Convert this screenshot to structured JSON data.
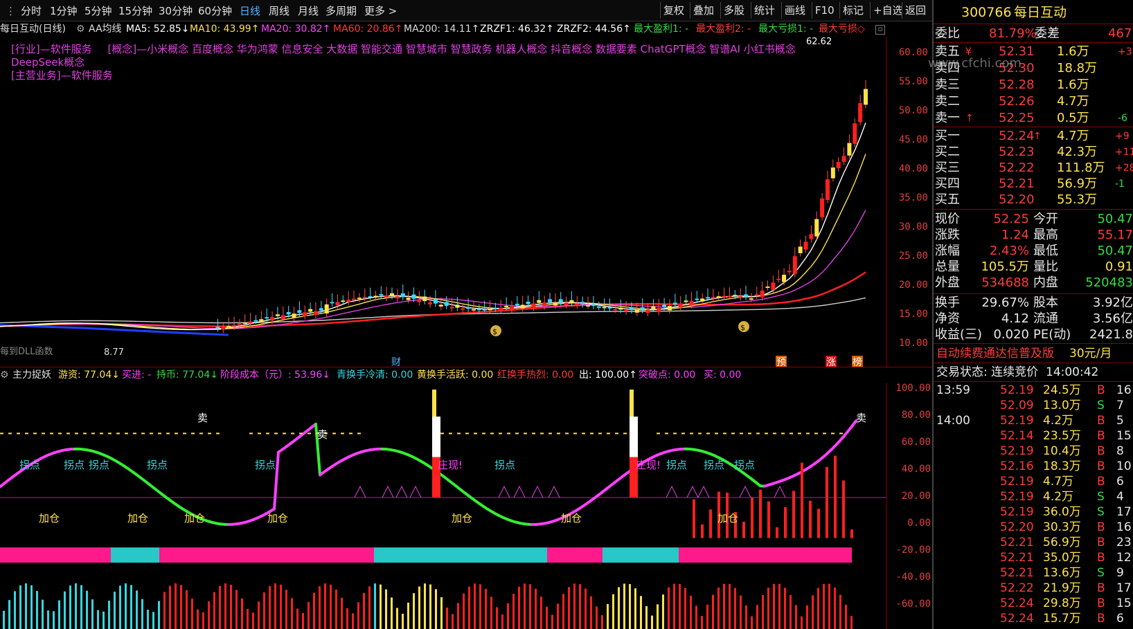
{
  "toolbar": {
    "periods": [
      "分时",
      "1分钟",
      "5分钟",
      "15分钟",
      "30分钟",
      "60分钟",
      "日线",
      "周线",
      "月线",
      "多周期",
      "更多 >"
    ],
    "active_period": "日线",
    "buttons": [
      "复权",
      "叠加",
      "多股",
      "统计",
      "画线",
      "F10",
      "标记",
      "+自选",
      "返回"
    ]
  },
  "main_chart": {
    "title": "每日互动(日线)",
    "indicator_name": "AA均线",
    "ma_labels": [
      {
        "text": "MA5: 52.85↓",
        "color": "#ffffff"
      },
      {
        "text": "MA10: 43.99↑",
        "color": "#ffe34a"
      },
      {
        "text": "MA20: 30.82↑",
        "color": "#ff40ff"
      },
      {
        "text": "MA60: 20.86↑",
        "color": "#ff3b3b"
      },
      {
        "text": "MA200: 14.11↑",
        "color": "#dddddd"
      },
      {
        "text": "ZRZF1: 46.32↑",
        "color": "#ffffff"
      },
      {
        "text": "ZRZF2: 44.56↑",
        "color": "#ffffff"
      },
      {
        "text": "最大盈利1: -",
        "color": "#33dd44"
      },
      {
        "text": "最大盈利2: -",
        "color": "#ff3b3b"
      },
      {
        "text": "最大亏损1: -",
        "color": "#33dd44"
      },
      {
        "text": "最大亏损◇",
        "color": "#ff3b3b"
      }
    ],
    "industry": "[行业]—软件服务",
    "concepts": "[概念]—小米概念 百度概念 华为鸿蒙 信息安全 大数据 智能交通 智慧城市 智慧政务 机器人概念 抖音概念 数据要素 ChatGPT概念 智谱AI 小红书概念 DeepSeek概念",
    "main_business": "[主营业务]—软件服务",
    "high_label": "62.62",
    "low_label": "8.77",
    "bottom_left_label": "每到DLL函数",
    "event_markers": [
      "财",
      "预",
      "涨",
      "榜"
    ],
    "y_axis": [
      "60.00",
      "55.00",
      "50.00",
      "45.00",
      "40.00",
      "35.00",
      "30.00",
      "25.00",
      "20.00",
      "15.00",
      "10.00"
    ],
    "watermark": "www.cfchi.com"
  },
  "indicator_chart": {
    "name": "主力捉妖",
    "labels": [
      {
        "text": "游资: 77.04↓",
        "color": "#ffe34a"
      },
      {
        "text": "买进: -",
        "color": "#ff40ff"
      },
      {
        "text": "持币: 77.04↓",
        "color": "#33dd44"
      },
      {
        "text": "阶段成本（元）: 53.96↓",
        "color": "#ff40ff"
      },
      {
        "text": "青换手冷清: 0.00",
        "color": "#36d6e0"
      },
      {
        "text": "黄换手活跃: 0.00",
        "color": "#ffe34a"
      },
      {
        "text": "红换手热烈: 0.00",
        "color": "#ff3b3b"
      },
      {
        "text": "出: 100.00↑",
        "color": "#ffffff"
      },
      {
        "text": "突破点: 0.00",
        "color": "#ff40ff"
      },
      {
        "text": "买: 0.00",
        "color": "#ff40ff"
      }
    ],
    "y_axis": [
      "100.00",
      "80.00",
      "60.00",
      "40.00",
      "20.00",
      "0.00",
      "-20.00",
      "-40.00",
      "-60.00"
    ],
    "annotations": {
      "sell": "卖",
      "turn": "拐点",
      "add": "加仓",
      "zhuang": "庄现!"
    }
  },
  "quote": {
    "code": "300766",
    "name": "每日互动",
    "weibi_label": "委比",
    "weibi": "81.79%",
    "weicha_label": "委差",
    "weicha": "467",
    "sells": [
      {
        "label": "卖五",
        "price": "52.31",
        "vol": "1.6万",
        "chg": "+3",
        "arrow": "¥"
      },
      {
        "label": "卖四",
        "price": "52.30",
        "vol": "18.8万",
        "chg": "",
        "arrow": ""
      },
      {
        "label": "卖三",
        "price": "52.28",
        "vol": "1.6万",
        "chg": "",
        "arrow": ""
      },
      {
        "label": "卖二",
        "price": "52.26",
        "vol": "4.7万",
        "chg": "",
        "arrow": ""
      },
      {
        "label": "卖一",
        "price": "52.25",
        "vol": "0.5万",
        "chg": "-6",
        "arrow": "↑"
      }
    ],
    "buys": [
      {
        "label": "买一",
        "price": "52.24",
        "vol": "4.7万",
        "chg": "+9",
        "arrow": "↑"
      },
      {
        "label": "买二",
        "price": "52.23",
        "vol": "42.3万",
        "chg": "+11",
        "arrow": ""
      },
      {
        "label": "买三",
        "price": "52.22",
        "vol": "111.8万",
        "chg": "+28",
        "arrow": ""
      },
      {
        "label": "买四",
        "price": "52.21",
        "vol": "56.9万",
        "chg": "-1",
        "arrow": ""
      },
      {
        "label": "买五",
        "price": "52.20",
        "vol": "55.3万",
        "chg": "",
        "arrow": ""
      }
    ],
    "stats": [
      {
        "l1": "现价",
        "v1": "52.25",
        "l2": "今开",
        "v2": "50.47",
        "c1": "red",
        "c2": "green"
      },
      {
        "l1": "涨跌",
        "v1": "1.24",
        "l2": "最高",
        "v2": "55.17",
        "c1": "red",
        "c2": "red"
      },
      {
        "l1": "涨幅",
        "v1": "2.43%",
        "l2": "最低",
        "v2": "50.47",
        "c1": "red",
        "c2": "green"
      },
      {
        "l1": "总量",
        "v1": "105.5万",
        "l2": "量比",
        "v2": "0.91",
        "c1": "yellow",
        "c2": "yellow"
      },
      {
        "l1": "外盘",
        "v1": "534688",
        "l2": "内盘",
        "v2": "520483",
        "c1": "red",
        "c2": "green"
      }
    ],
    "stats2": [
      {
        "l1": "换手",
        "v1": "29.67%",
        "l2": "股本",
        "v2": "3.92亿"
      },
      {
        "l1": "净资",
        "v1": "4.12",
        "l2": "流通",
        "v2": "3.56亿"
      },
      {
        "l1": "收益(三)",
        "v1": "0.020",
        "l2": "PE(动)",
        "v2": "2421.8"
      }
    ],
    "promo": "自动续费通达信普及版",
    "promo_price": "30元/月",
    "trade_status_label": "交易状态: 连续竞价",
    "trade_time": "14:00:42",
    "ticks": [
      {
        "t": "13:59",
        "p": "52.19",
        "v": "24.5万",
        "bs": "B",
        "n": "16"
      },
      {
        "t": "",
        "p": "52.09",
        "v": "13.0万",
        "bs": "S",
        "n": "7"
      },
      {
        "t": "14:00",
        "p": "52.19",
        "v": "4.2万",
        "bs": "B",
        "n": "5"
      },
      {
        "t": "",
        "p": "52.14",
        "v": "23.5万",
        "bs": "B",
        "n": "15"
      },
      {
        "t": "",
        "p": "52.19",
        "v": "10.4万",
        "bs": "B",
        "n": "8"
      },
      {
        "t": "",
        "p": "52.16",
        "v": "18.3万",
        "bs": "B",
        "n": "10"
      },
      {
        "t": "",
        "p": "52.19",
        "v": "4.7万",
        "bs": "B",
        "n": "6"
      },
      {
        "t": "",
        "p": "52.19",
        "v": "4.2万",
        "bs": "S",
        "n": "4"
      },
      {
        "t": "",
        "p": "52.19",
        "v": "36.0万",
        "bs": "S",
        "n": "17"
      },
      {
        "t": "",
        "p": "52.20",
        "v": "30.3万",
        "bs": "B",
        "n": "16"
      },
      {
        "t": "",
        "p": "52.21",
        "v": "56.9万",
        "bs": "B",
        "n": "23"
      },
      {
        "t": "",
        "p": "52.21",
        "v": "35.0万",
        "bs": "B",
        "n": "12"
      },
      {
        "t": "",
        "p": "52.21",
        "v": "13.6万",
        "bs": "S",
        "n": "9"
      },
      {
        "t": "",
        "p": "52.22",
        "v": "21.9万",
        "bs": "B",
        "n": "17"
      },
      {
        "t": "",
        "p": "52.24",
        "v": "29.8万",
        "bs": "B",
        "n": "15"
      },
      {
        "t": "",
        "p": "52.24",
        "v": "15.7万",
        "bs": "B",
        "n": "6"
      }
    ]
  }
}
